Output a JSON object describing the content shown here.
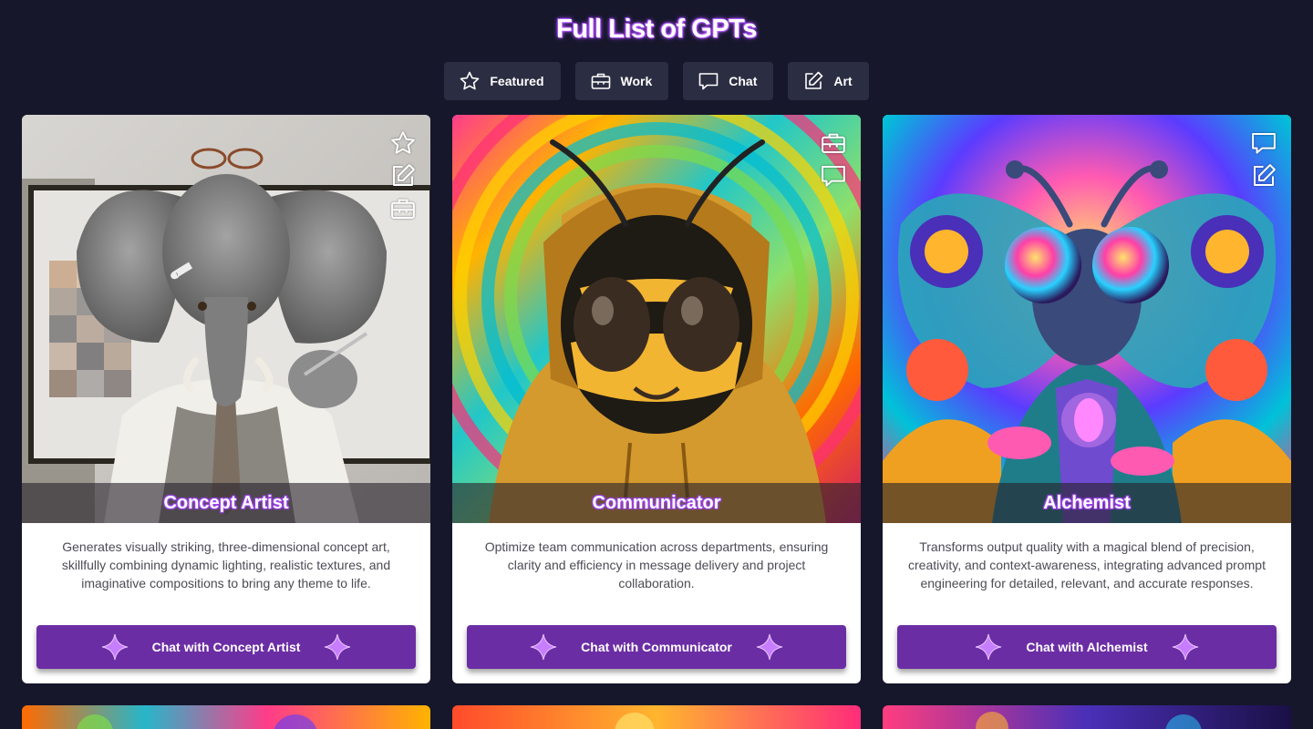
{
  "page": {
    "title": "Full List of GPTs"
  },
  "filters": [
    {
      "label": "Featured",
      "icon": "star-icon"
    },
    {
      "label": "Work",
      "icon": "briefcase-icon"
    },
    {
      "label": "Chat",
      "icon": "chat-bubble-icon"
    },
    {
      "label": "Art",
      "icon": "edit-icon"
    }
  ],
  "cards": [
    {
      "name": "Concept Artist",
      "description": "Generates visually striking, three-dimensional concept art, skillfully combining dynamic lighting, realistic textures, and imaginative compositions to bring any theme to life.",
      "button_label": "Chat with Concept Artist",
      "tags": [
        "star-icon",
        "edit-icon",
        "briefcase-icon"
      ]
    },
    {
      "name": "Communicator",
      "description": "Optimize team communication across departments, ensuring clarity and efficiency in message delivery and project collaboration.",
      "button_label": "Chat with Communicator",
      "tags": [
        "briefcase-icon",
        "chat-bubble-icon"
      ]
    },
    {
      "name": "Alchemist",
      "description": "Transforms output quality with a magical blend of precision, creativity, and context-awareness, integrating advanced prompt engineering for detailed, relevant, and accurate responses.",
      "button_label": "Chat with Alchemist",
      "tags": [
        "chat-bubble-icon",
        "edit-icon"
      ]
    }
  ],
  "colors": {
    "background": "#16172b",
    "filter_button": "#2b2d42",
    "chat_button": "#6b2da4",
    "title_glow": "#a14dff",
    "sparkle": "#c77dff"
  }
}
